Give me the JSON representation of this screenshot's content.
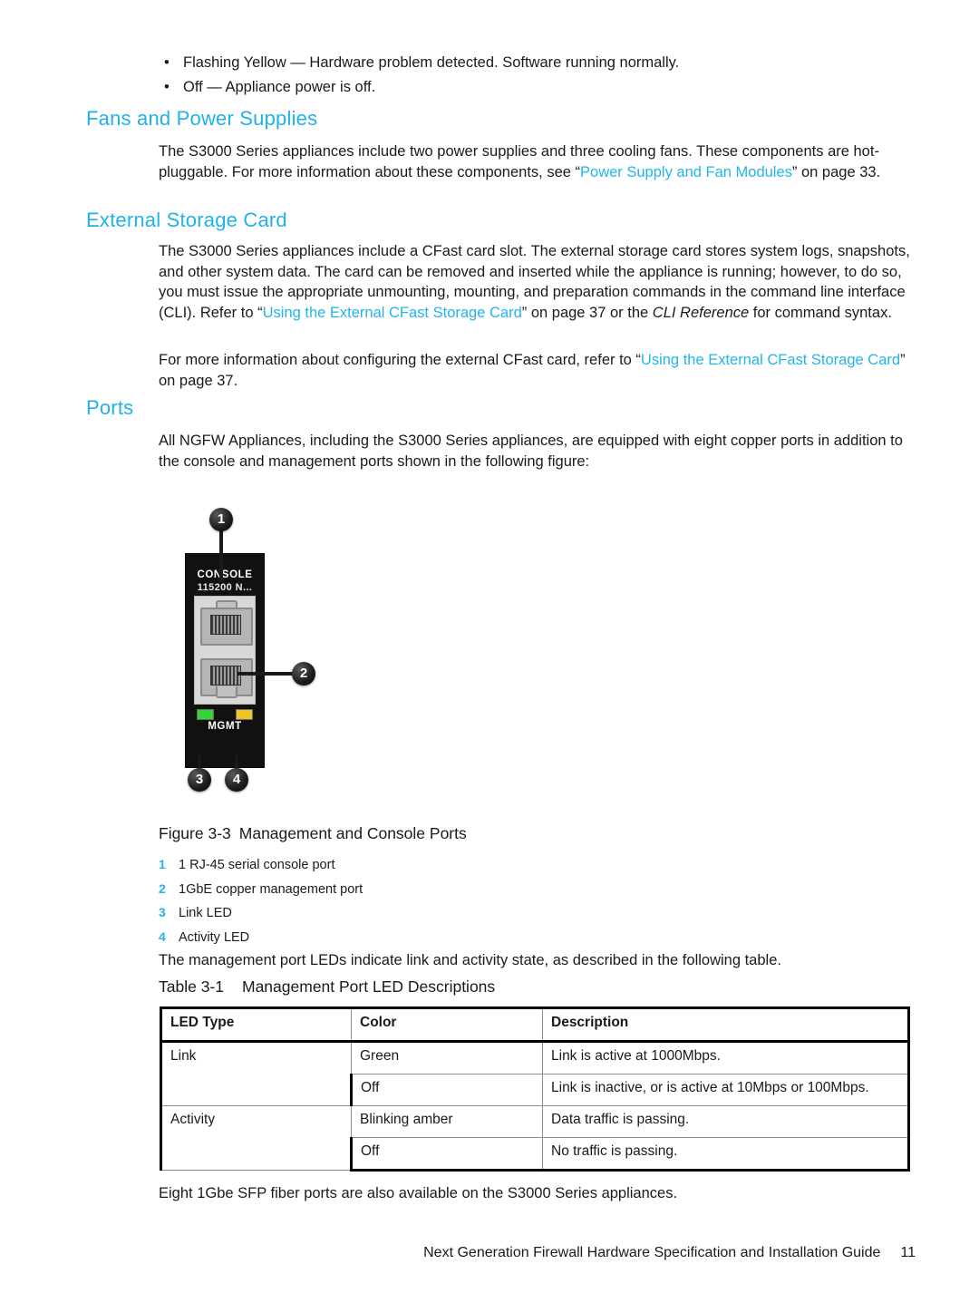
{
  "bullets": [
    "Flashing Yellow — Hardware problem detected. Software running normally.",
    "Off — Appliance power is off."
  ],
  "headings": {
    "fans_power_supplies": "Fans and Power Supplies",
    "external_storage_card": "External Storage Card",
    "ports": "Ports"
  },
  "paragraphs": {
    "fans_1": "The S3000 Series appliances include two power supplies and three cooling fans. These components are hot-pluggable. For more information about these components, see “",
    "fans_link": "Power Supply and Fan Modules",
    "fans_2": "” on page 33.",
    "esc_1": "The S3000 Series appliances include a CFast card slot. The external storage card stores system logs, snapshots, and other system data. The card can be removed and inserted while the appliance is running; however, to do so, you must issue the appropriate unmounting, mounting, and preparation commands in the command line interface (CLI). Refer to “",
    "esc_link": "Using the External CFast Storage Card",
    "esc_2": "” on page 37 or the ",
    "esc_italic": "CLI Reference",
    "esc_3": " for command syntax.",
    "esc2_1": "For more information about configuring the external CFast card, refer to “",
    "esc2_link": "Using the External CFast Storage Card",
    "esc2_2": "” on page 37.",
    "ports_1": "All NGFW Appliances, including the S3000 Series appliances, are equipped with eight copper ports in addition to the console and management ports shown in the following figure:",
    "leds_intro": "The management port LEDs indicate link and activity state, as described in the following table.",
    "sfp": "Eight 1Gbe SFP fiber ports are also available on the S3000 Series appliances."
  },
  "figure": {
    "caption_number": "Figure 3-3",
    "caption_title": "Management and Console Ports",
    "device": {
      "console_label": "CONSOLE",
      "baud_label": "115200 N...",
      "mgmt_label": "MGMT",
      "link_led_color": "#35d435",
      "activity_led_color": "#f2c322"
    },
    "callouts": [
      {
        "number": "1"
      },
      {
        "number": "2"
      },
      {
        "number": "3"
      },
      {
        "number": "4"
      }
    ],
    "legend": [
      {
        "num": "1",
        "text": "1 RJ-45 serial console port"
      },
      {
        "num": "2",
        "text": "1GbE copper management port"
      },
      {
        "num": "3",
        "text": "Link LED"
      },
      {
        "num": "4",
        "text": "Activity LED"
      }
    ]
  },
  "table": {
    "caption_number": "Table 3-1",
    "caption_title": "Management Port LED Descriptions",
    "headers": [
      "LED Type",
      "Color",
      "Description"
    ],
    "rows": [
      {
        "led_type": "Link",
        "color": "Green",
        "description": "Link is active at 1000Mbps."
      },
      {
        "led_type": "",
        "color": "Off",
        "description": "Link is inactive, or is active at 10Mbps or 100Mbps."
      },
      {
        "led_type": "Activity",
        "color": "Blinking amber",
        "description": "Data traffic is passing."
      },
      {
        "led_type": "",
        "color": "Off",
        "description": "No traffic is passing."
      }
    ]
  },
  "footer": {
    "guide_title": "Next Generation Firewall Hardware Specification and Installation Guide",
    "page_number": "11"
  },
  "colors": {
    "heading": "#1eb2e8",
    "link": "#22b4ea",
    "text": "#1a1a1a"
  }
}
